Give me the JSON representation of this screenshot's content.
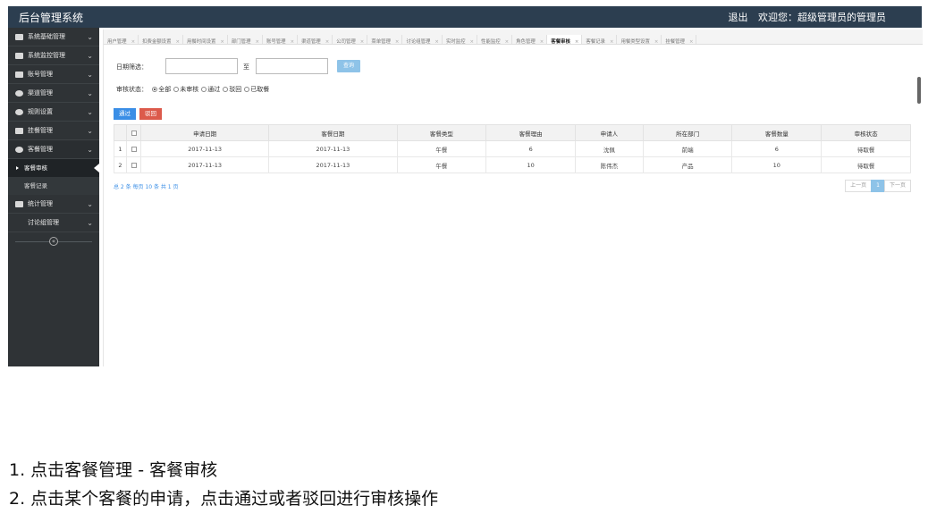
{
  "app": {
    "title": "后台管理系统",
    "logout_label": "退出",
    "welcome_text": "欢迎您：超级管理员的管理员"
  },
  "sidebar": {
    "items": [
      {
        "label": "系统基础管理",
        "icon": "monitor-icon"
      },
      {
        "label": "系统监控管理",
        "icon": "tag-icon"
      },
      {
        "label": "账号管理",
        "icon": "image-icon"
      },
      {
        "label": "渠道管理",
        "icon": "share-icon"
      },
      {
        "label": "规则设置",
        "icon": "gears-icon"
      },
      {
        "label": "挂餐管理",
        "icon": "hand-icon"
      },
      {
        "label": "客餐管理",
        "icon": "users-icon"
      }
    ],
    "sub_items": [
      {
        "label": "客餐审核",
        "active": true
      },
      {
        "label": "客餐记录",
        "active": false
      }
    ],
    "more_items": [
      {
        "label": "统计管理",
        "icon": "file-icon"
      },
      {
        "label": "讨论组管理",
        "icon": ""
      }
    ],
    "collapse_symbol": "«"
  },
  "tabs": [
    {
      "label": "用户管理"
    },
    {
      "label": "扣费金额设置"
    },
    {
      "label": "用餐时间设置"
    },
    {
      "label": "部门管理"
    },
    {
      "label": "账号管理"
    },
    {
      "label": "渠道管理"
    },
    {
      "label": "公司管理"
    },
    {
      "label": "菜单管理"
    },
    {
      "label": "讨论组管理"
    },
    {
      "label": "实时监控"
    },
    {
      "label": "性能监控"
    },
    {
      "label": "角色管理"
    },
    {
      "label": "客餐审核",
      "active": true
    },
    {
      "label": "客餐记录"
    },
    {
      "label": "用餐类型设置"
    },
    {
      "label": "挂餐管理"
    }
  ],
  "tab_close_symbol": "×",
  "filter": {
    "date_label": "日期筛选：",
    "to_label": "至",
    "date_from_value": "",
    "date_to_value": "",
    "query_label": "查询",
    "status_label": "审核状态：",
    "status_options": [
      {
        "label": "全部",
        "checked": true
      },
      {
        "label": "未审核",
        "checked": false
      },
      {
        "label": "通过",
        "checked": false
      },
      {
        "label": "驳回",
        "checked": false
      },
      {
        "label": "已取餐",
        "checked": false
      }
    ]
  },
  "actions": {
    "pass_label": "通过",
    "reject_label": "驳回"
  },
  "table": {
    "columns": [
      "申请日期",
      "客餐日期",
      "客餐类型",
      "客餐理由",
      "申请人",
      "所在部门",
      "客餐数量",
      "审核状态"
    ],
    "rows": [
      {
        "index": "1",
        "apply_date": "2017-11-13",
        "meal_date": "2017-11-13",
        "meal_type": "午餐",
        "reason": "6",
        "applicant": "沈佩",
        "department": "前端",
        "quantity": "6",
        "status": "待取餐"
      },
      {
        "index": "2",
        "apply_date": "2017-11-13",
        "meal_date": "2017-11-13",
        "meal_type": "午餐",
        "reason": "10",
        "applicant": "陈伟杰",
        "department": "产品",
        "quantity": "10",
        "status": "待取餐"
      }
    ]
  },
  "pagination": {
    "info": "总 2 条  每页 10 条  共 1 页",
    "prev_label": "上一页",
    "current_page": "1",
    "next_label": "下一页"
  },
  "instructions": [
    "1. 点击客餐管理 - 客餐审核",
    "2. 点击某个客餐的申请，点击通过或者驳回进行审核操作"
  ],
  "colors": {
    "topbar": "#2c3e50",
    "sidebar": "#2f3336",
    "primary": "#3a8ee6",
    "danger": "#dc5a4b"
  }
}
